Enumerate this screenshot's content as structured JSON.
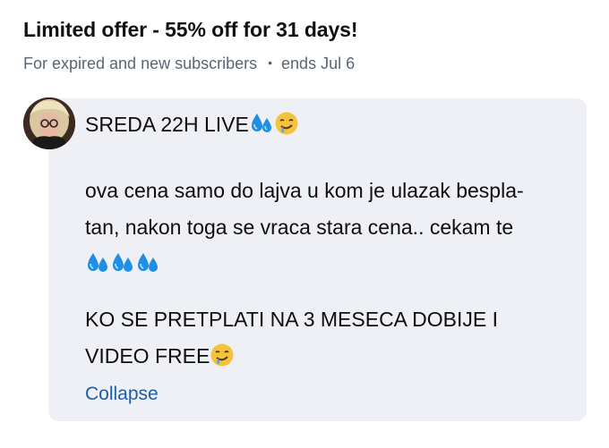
{
  "offer": {
    "title": "Limited offer - 55% off for 31 days!",
    "subtitle": "For expired and new subscribers",
    "separator": "•",
    "ends": "ends Jul 6"
  },
  "post": {
    "line1": "SREDA 22H LIVE",
    "line2a": "ova cena samo do lajva u kom je ulazak bespla-",
    "line2b": "tan, nakon toga se vraca stara cena.. cekam te",
    "line3a": "KO SE PRETPLATI NA 3 MESECA DOBIJE I",
    "line3b": "VIDEO FREE",
    "collapse_label": "Collapse"
  },
  "icons": {
    "sweat": "sweat-droplets-icon",
    "drool": "drooling-face-icon"
  },
  "colors": {
    "card_bg": "#eef0f5",
    "link": "#1c5fa8",
    "muted": "#5b6675"
  }
}
